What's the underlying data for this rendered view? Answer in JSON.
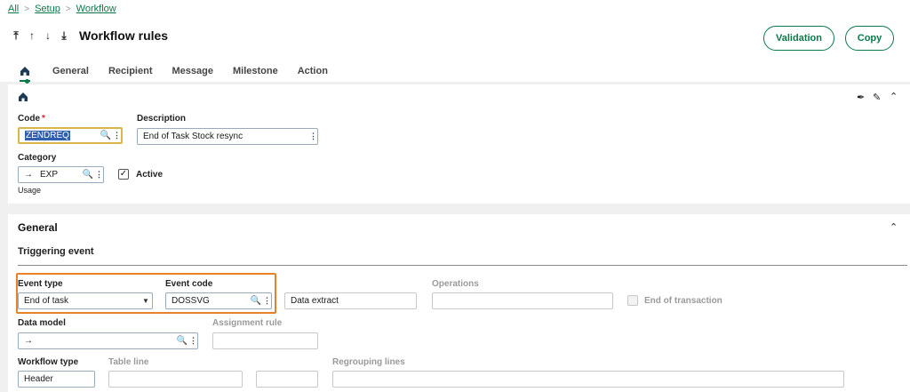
{
  "breadcrumb": [
    "All",
    "Setup",
    "Workflow"
  ],
  "page": {
    "title": "Workflow rules"
  },
  "actions": {
    "validation_label": "Validation",
    "copy_label": "Copy"
  },
  "tabs": [
    "General",
    "Recipient",
    "Message",
    "Milestone",
    "Action"
  ],
  "header": {
    "code_label": "Code",
    "code_value": "ZENDREQ",
    "description_label": "Description",
    "description_value": "End of Task Stock resync",
    "category_label": "Category",
    "category_value": "EXP",
    "category_note": "Usage",
    "active_label": "Active",
    "active_checked": true
  },
  "general": {
    "section_title": "General",
    "triggering_title": "Triggering event",
    "event_type_label": "Event type",
    "event_type_value": "End of task",
    "event_code_label": "Event code",
    "event_code_value": "DOSSVG",
    "event_code_desc": "Data extract",
    "operations_label": "Operations",
    "operations_value": "",
    "end_of_transaction_label": "End of transaction",
    "data_model_label": "Data model",
    "data_model_value": "",
    "assignment_rule_label": "Assignment rule",
    "workflow_type_label": "Workflow type",
    "workflow_type_value": "Header",
    "table_line_label": "Table line",
    "regrouping_lines_label": "Regrouping lines"
  },
  "colors": {
    "accent": "#0a7a4a",
    "highlight": "#e8822a"
  }
}
